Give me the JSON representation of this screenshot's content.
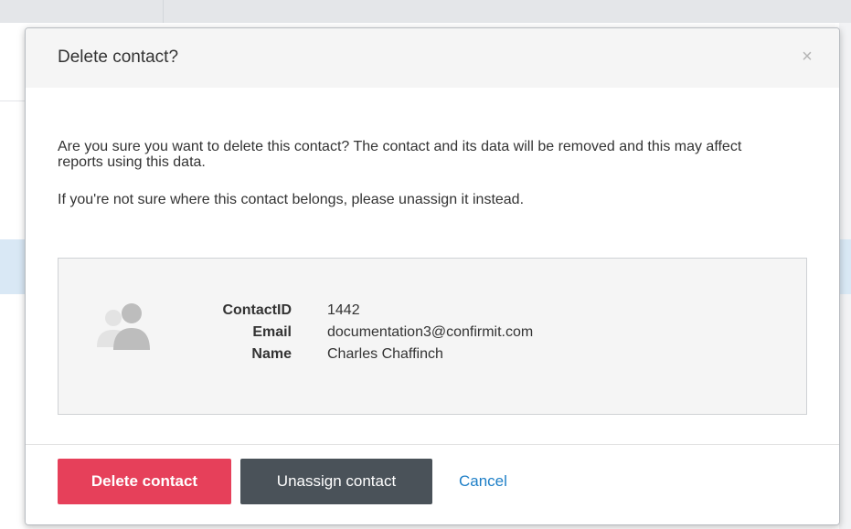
{
  "dialog": {
    "title": "Delete contact?",
    "close_glyph": "×",
    "message_primary": "Are you sure you want to delete this contact? The contact and its data will be removed and this may affect reports using this data.",
    "message_secondary": "If you're not sure where this contact belongs, please unassign it instead."
  },
  "contact": {
    "avatar_icon": "contacts-avatar-icon",
    "fields": [
      {
        "label": "ContactID",
        "value": "1442"
      },
      {
        "label": "Email",
        "value": "documentation3@confirmit.com"
      },
      {
        "label": "Name",
        "value": "Charles Chaffinch"
      }
    ]
  },
  "actions": {
    "delete_label": "Delete contact",
    "unassign_label": "Unassign contact",
    "cancel_label": "Cancel"
  },
  "colors": {
    "delete_button": "#e6405a",
    "unassign_button": "#4a5259",
    "cancel_link": "#1e7fc7",
    "header_bg": "#f5f5f5"
  }
}
